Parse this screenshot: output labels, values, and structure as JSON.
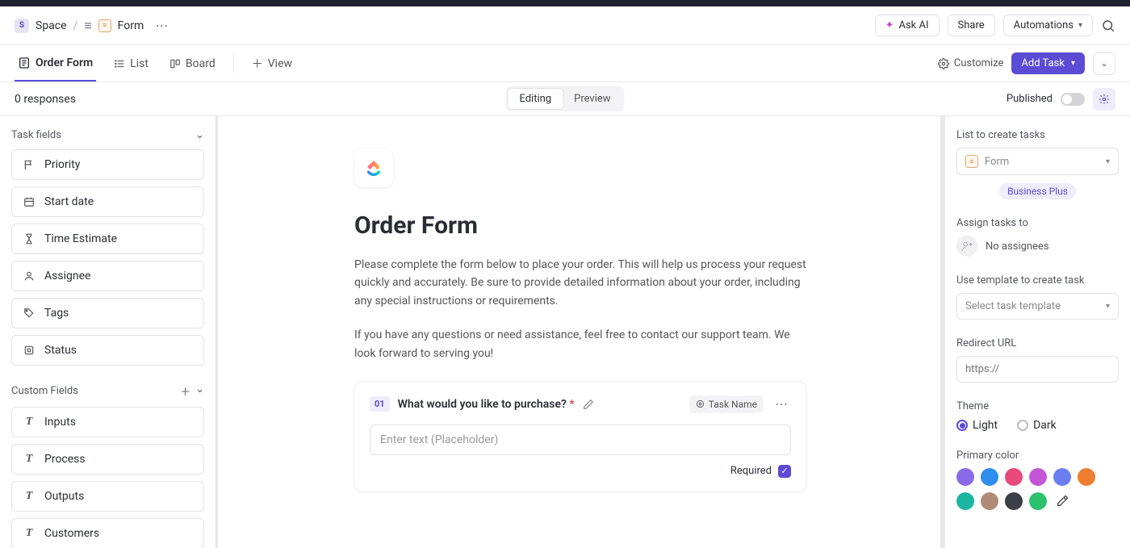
{
  "breadcrumb": {
    "space_initial": "S",
    "space_label": "Space",
    "form_label": "Form"
  },
  "topActions": {
    "ask_ai": "Ask AI",
    "share": "Share",
    "automations": "Automations"
  },
  "views": {
    "order_form": "Order Form",
    "list": "List",
    "board": "Board",
    "add_view": "View",
    "customize": "Customize",
    "add_task": "Add Task"
  },
  "modeRow": {
    "responses": "0 responses",
    "editing": "Editing",
    "preview": "Preview",
    "published": "Published"
  },
  "leftPanel": {
    "task_fields_header": "Task fields",
    "task_fields": [
      {
        "icon": "flag-icon",
        "label": "Priority"
      },
      {
        "icon": "calendar-icon",
        "label": "Start date"
      },
      {
        "icon": "hourglass-icon",
        "label": "Time Estimate"
      },
      {
        "icon": "user-icon",
        "label": "Assignee"
      },
      {
        "icon": "tag-icon",
        "label": "Tags"
      },
      {
        "icon": "status-icon",
        "label": "Status"
      }
    ],
    "custom_fields_header": "Custom Fields",
    "custom_fields": [
      {
        "icon": "text-icon",
        "label": "Inputs"
      },
      {
        "icon": "text-icon",
        "label": "Process"
      },
      {
        "icon": "text-icon",
        "label": "Outputs"
      },
      {
        "icon": "text-icon",
        "label": "Customers"
      }
    ]
  },
  "form": {
    "title": "Order Form",
    "desc1": "Please complete the form below to place your order. This will help us process your request quickly and accurately. Be sure to provide detailed information about your order, including any special instructions or requirements.",
    "desc2": "If you have any questions or need assistance, feel free to contact our support team. We look forward to serving you!",
    "question": {
      "number": "01",
      "label": "What would you like to purchase?",
      "badge": "Task Name",
      "placeholder": "Enter text (Placeholder)",
      "required_label": "Required"
    }
  },
  "rightPanel": {
    "list_label": "List to create tasks",
    "list_value": "Form",
    "business_plus": "Business Plus",
    "assign_label": "Assign tasks to",
    "no_assignees": "No assignees",
    "template_label": "Use template to create task",
    "template_placeholder": "Select task template",
    "redirect_label": "Redirect URL",
    "redirect_placeholder": "https://",
    "theme_label": "Theme",
    "theme_light": "Light",
    "theme_dark": "Dark",
    "primary_label": "Primary color",
    "colors": [
      "#8a6ae6",
      "#2f8eeb",
      "#e84a7d",
      "#c355d6",
      "#6b7ff2",
      "#ee7d2f",
      "#1cb5a1",
      "#b08b78",
      "#3d3f46",
      "#2cc26d"
    ]
  }
}
